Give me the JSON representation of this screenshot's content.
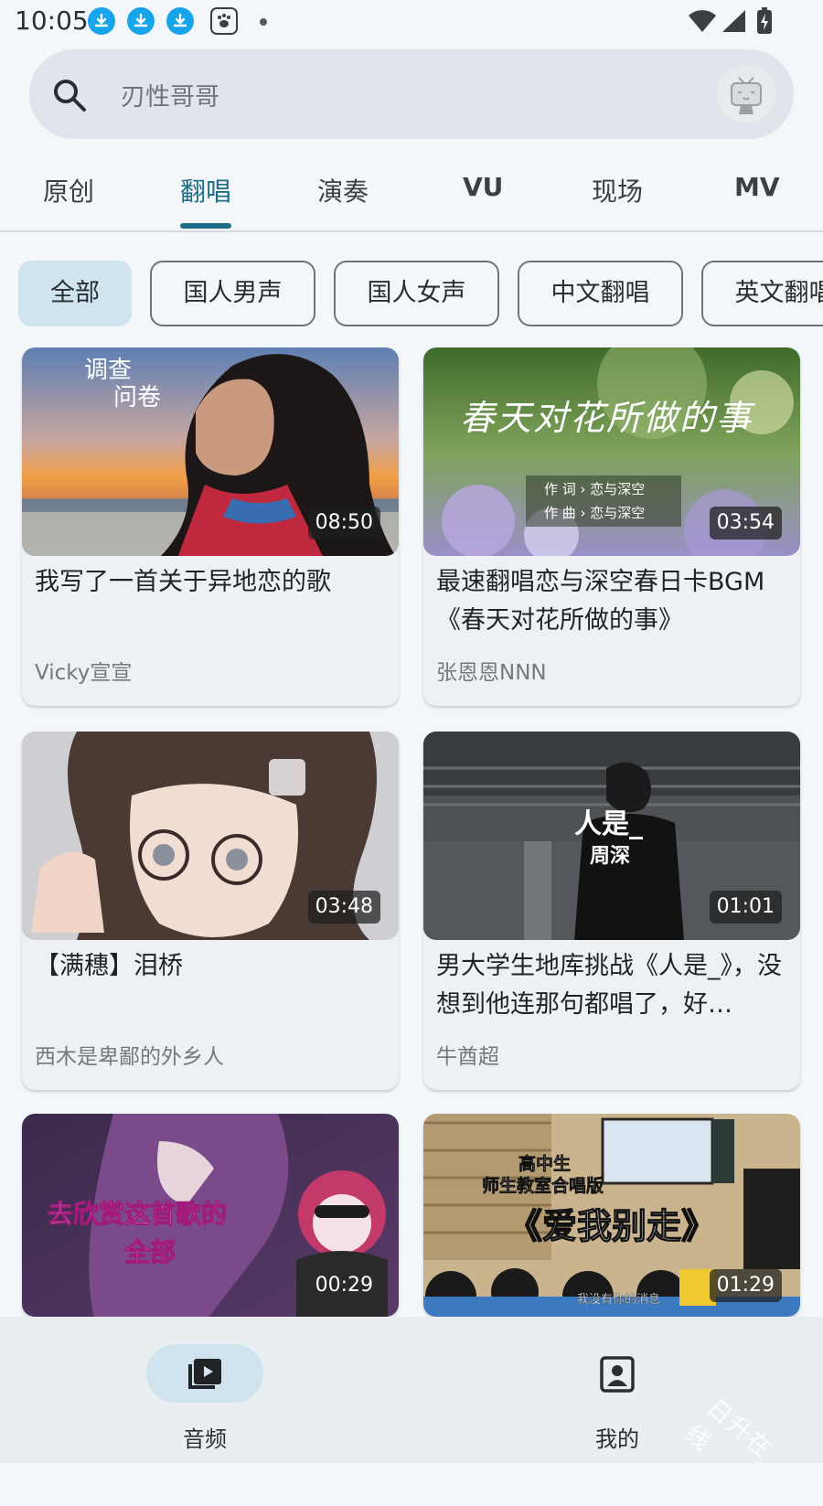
{
  "status_bar": {
    "time": "10:05",
    "icons": [
      "download-icon",
      "download-icon",
      "download-icon",
      "paw-icon",
      "dot-icon",
      "wifi-icon",
      "signal-icon",
      "battery-charging-icon"
    ]
  },
  "search": {
    "placeholder": "刃性哥哥"
  },
  "tabs": [
    {
      "label": "原创"
    },
    {
      "label": "翻唱",
      "active": true
    },
    {
      "label": "演奏"
    },
    {
      "label": "VU"
    },
    {
      "label": "现场"
    },
    {
      "label": "MV"
    }
  ],
  "chips": [
    {
      "label": "全部",
      "selected": true
    },
    {
      "label": "国人男声"
    },
    {
      "label": "国人女声"
    },
    {
      "label": "中文翻唱"
    },
    {
      "label": "英文翻唱"
    }
  ],
  "cards": [
    {
      "title": "我写了一首关于异地恋的歌",
      "author": "Vicky宣宣",
      "duration": "08:50",
      "thumb_text": [
        "调查",
        "问卷"
      ]
    },
    {
      "title": "最速翻唱恋与深空春日卡BGM《春天对花所做的事》",
      "author": "张恩恩NNN",
      "duration": "03:54",
      "thumb_text": [
        "春天对花所做的事",
        "作 词 › 恋与深空",
        "作 曲 › 恋与深空"
      ]
    },
    {
      "title": "【满穗】泪桥",
      "author": "西木是卑鄙的外乡人",
      "duration": "03:48",
      "thumb_text": []
    },
    {
      "title": "男大学生地库挑战《人是_》，没想到他连那句都唱了，好…",
      "author": "牛酋超",
      "duration": "01:01",
      "thumb_text": [
        "人是_",
        "周深"
      ]
    },
    {
      "title": "",
      "author": "",
      "duration": "00:29",
      "thumb_text": [
        "去欣赏这首歌的",
        "全部"
      ]
    },
    {
      "title": "",
      "author": "",
      "duration": "01:29",
      "thumb_text": [
        "高中生",
        "师生教室合唱版",
        "《爱我别走》",
        "我没有你的消息"
      ]
    }
  ],
  "bottom_nav": [
    {
      "label": "音频",
      "icon": "audio-library-icon",
      "active": true
    },
    {
      "label": "我的",
      "icon": "profile-icon",
      "active": false
    }
  ],
  "watermark": "日升在线",
  "colors": {
    "accent": "#1e6c86",
    "chip_selected": "#cfe4ef",
    "background": "#f4f7fa"
  }
}
